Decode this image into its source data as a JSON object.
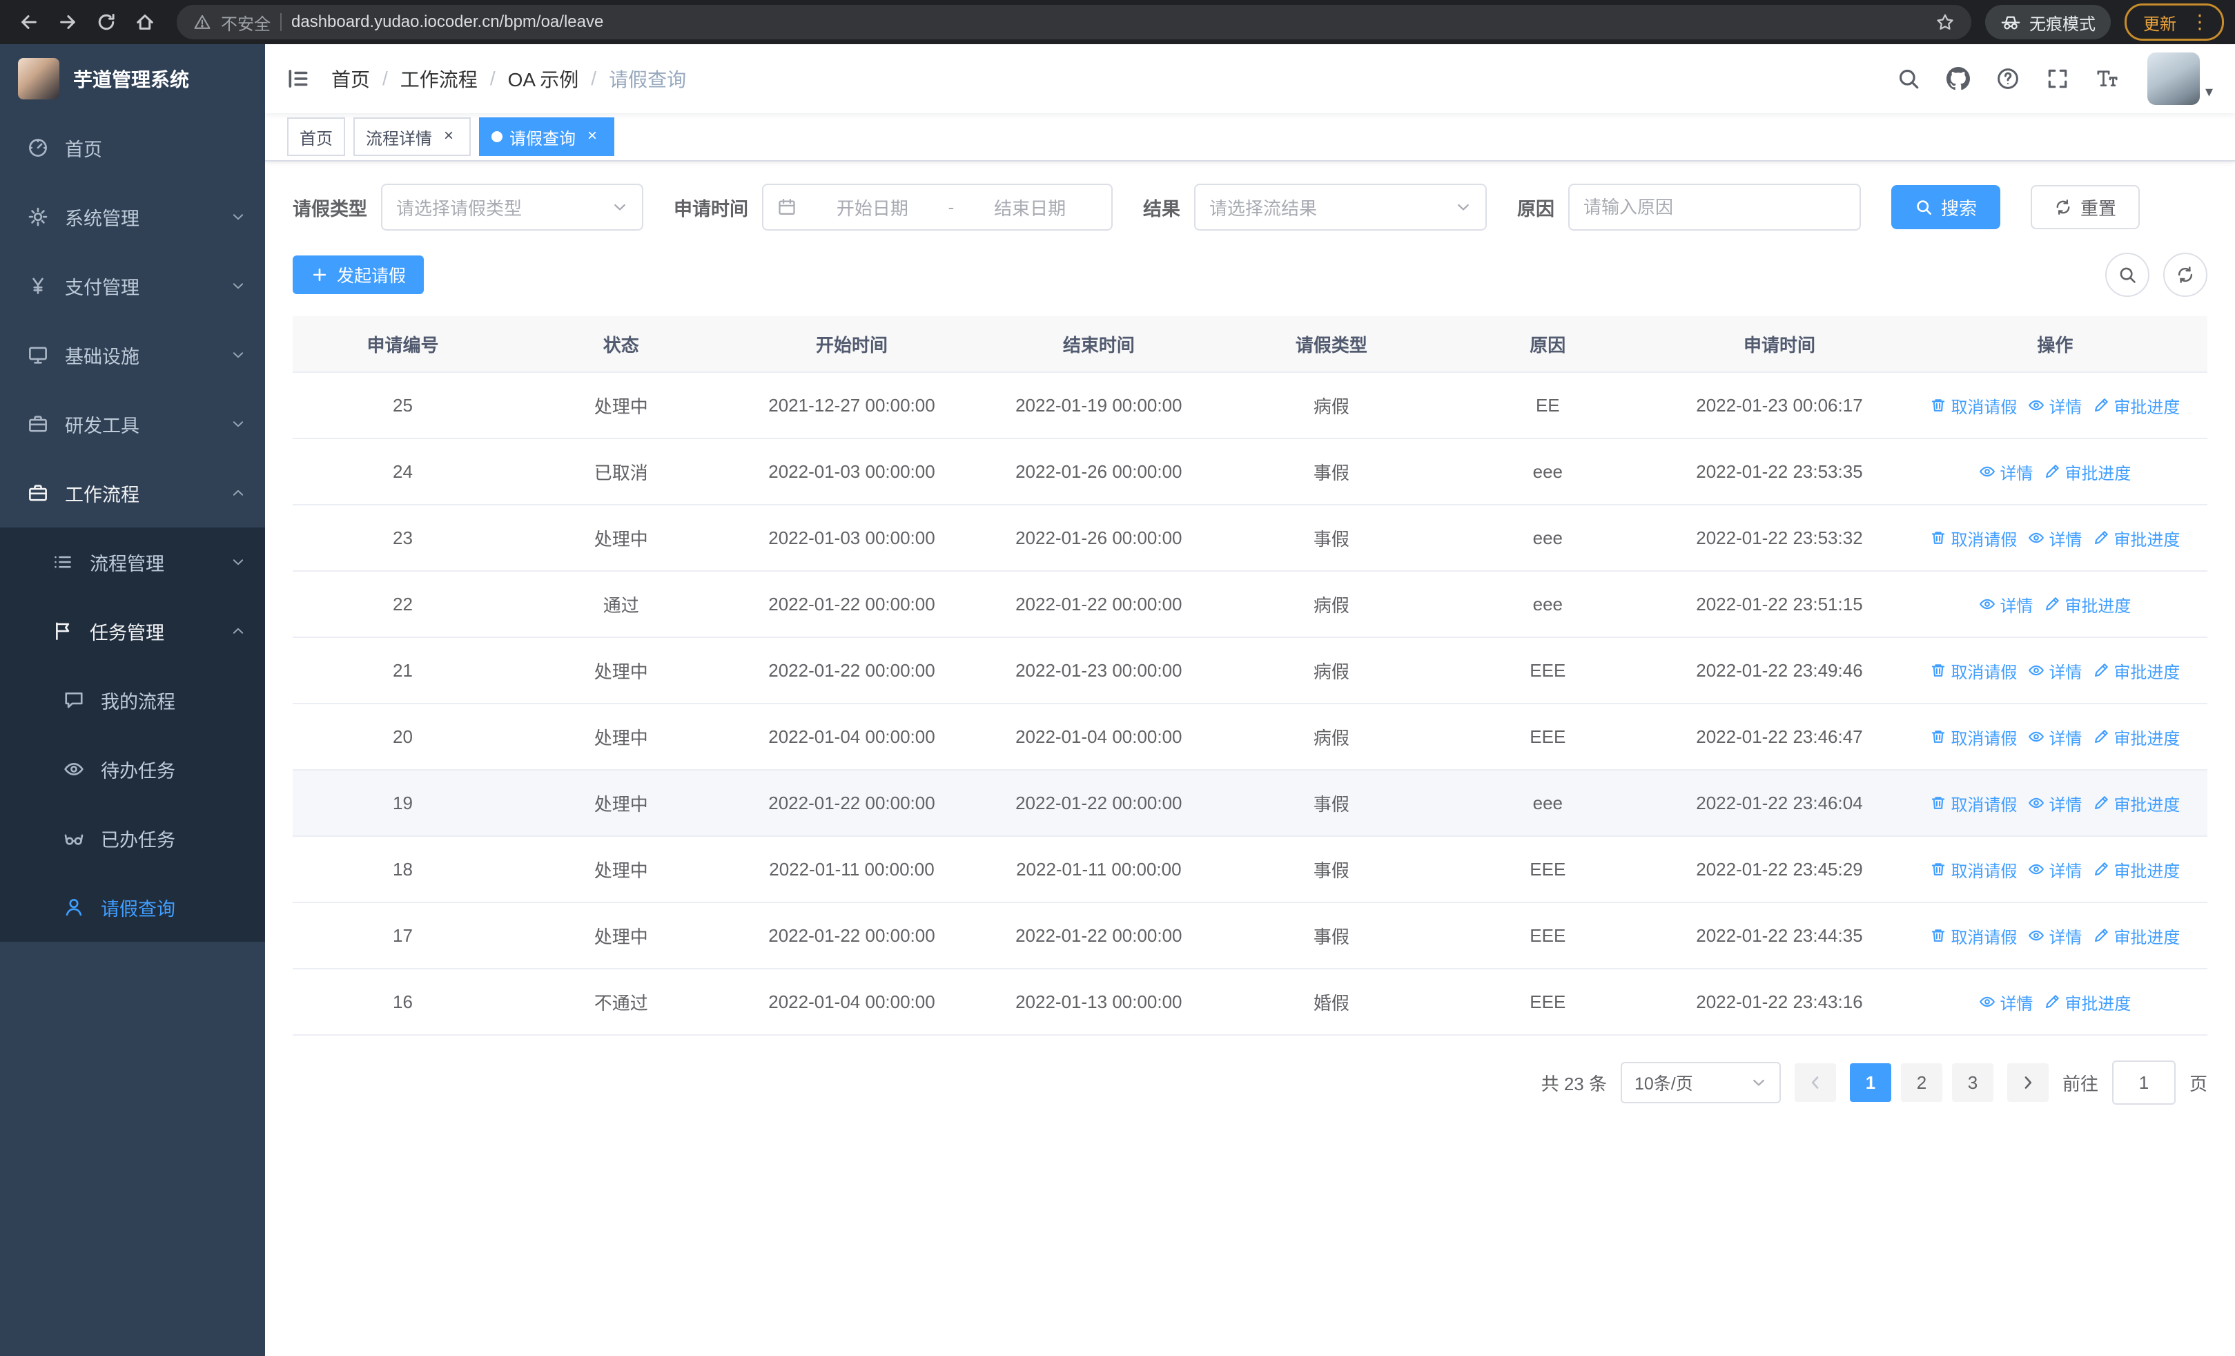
{
  "browser": {
    "security_chip": "不安全",
    "url": "dashboard.yudao.iocoder.cn/bpm/oa/leave",
    "incognito_label": "无痕模式",
    "update_label": "更新"
  },
  "app": {
    "logo_title": "芋道管理系统"
  },
  "sidebar": {
    "menu": [
      {
        "key": "home",
        "label": "首页",
        "icon": "dashboard-icon",
        "level": 1
      },
      {
        "key": "system",
        "label": "系统管理",
        "icon": "gear-icon",
        "level": 1,
        "arrow": "down"
      },
      {
        "key": "payment",
        "label": "支付管理",
        "icon": "yen-icon",
        "level": 1,
        "arrow": "down"
      },
      {
        "key": "infrastructure",
        "label": "基础设施",
        "icon": "monitor-icon",
        "level": 1,
        "arrow": "down"
      },
      {
        "key": "dev-tools",
        "label": "研发工具",
        "icon": "briefcase-icon",
        "level": 1,
        "arrow": "down"
      },
      {
        "key": "workflow",
        "label": "工作流程",
        "icon": "suitcase-icon",
        "level": 1,
        "arrow": "up",
        "open": true
      },
      {
        "key": "process-mgmt",
        "label": "流程管理",
        "icon": "list-icon",
        "level": 2,
        "arrow": "down"
      },
      {
        "key": "task-mgmt",
        "label": "任务管理",
        "icon": "flag-icon",
        "level": 2,
        "arrow": "up",
        "open": true
      },
      {
        "key": "my-process",
        "label": "我的流程",
        "icon": "chat-icon",
        "level": 3
      },
      {
        "key": "todo-tasks",
        "label": "待办任务",
        "icon": "eye-icon",
        "level": 3
      },
      {
        "key": "done-tasks",
        "label": "已办任务",
        "icon": "done-icon",
        "level": 3
      },
      {
        "key": "leave-query",
        "label": "请假查询",
        "icon": "user-icon",
        "level": 3,
        "active": true
      }
    ]
  },
  "header": {
    "breadcrumb": [
      "首页",
      "工作流程",
      "OA 示例",
      "请假查询"
    ]
  },
  "tags": [
    {
      "label": "首页",
      "closable": false,
      "active": false
    },
    {
      "label": "流程详情",
      "closable": true,
      "active": false
    },
    {
      "label": "请假查询",
      "closable": true,
      "active": true
    }
  ],
  "filters": {
    "leave_type_label": "请假类型",
    "leave_type_placeholder": "请选择请假类型",
    "apply_time_label": "申请时间",
    "start_placeholder": "开始日期",
    "range_separator": "-",
    "end_placeholder": "结束日期",
    "result_label": "结果",
    "result_placeholder": "请选择流结果",
    "reason_label": "原因",
    "reason_placeholder": "请输入原因",
    "search_label": "搜索",
    "reset_label": "重置"
  },
  "toolbar": {
    "create_label": "发起请假"
  },
  "table": {
    "columns": [
      "申请编号",
      "状态",
      "开始时间",
      "结束时间",
      "请假类型",
      "原因",
      "申请时间",
      "操作"
    ],
    "action_labels": {
      "cancel": "取消请假",
      "detail": "详情",
      "progress": "审批进度"
    },
    "rows": [
      {
        "id": "25",
        "status": "处理中",
        "start": "2021-12-27 00:00:00",
        "end": "2022-01-19 00:00:00",
        "type": "病假",
        "reason": "EE",
        "applied": "2022-01-23 00:06:17",
        "actions": [
          "cancel",
          "detail",
          "progress"
        ]
      },
      {
        "id": "24",
        "status": "已取消",
        "start": "2022-01-03 00:00:00",
        "end": "2022-01-26 00:00:00",
        "type": "事假",
        "reason": "eee",
        "applied": "2022-01-22 23:53:35",
        "actions": [
          "detail",
          "progress"
        ]
      },
      {
        "id": "23",
        "status": "处理中",
        "start": "2022-01-03 00:00:00",
        "end": "2022-01-26 00:00:00",
        "type": "事假",
        "reason": "eee",
        "applied": "2022-01-22 23:53:32",
        "actions": [
          "cancel",
          "detail",
          "progress"
        ]
      },
      {
        "id": "22",
        "status": "通过",
        "start": "2022-01-22 00:00:00",
        "end": "2022-01-22 00:00:00",
        "type": "病假",
        "reason": "eee",
        "applied": "2022-01-22 23:51:15",
        "actions": [
          "detail",
          "progress"
        ]
      },
      {
        "id": "21",
        "status": "处理中",
        "start": "2022-01-22 00:00:00",
        "end": "2022-01-23 00:00:00",
        "type": "病假",
        "reason": "EEE",
        "applied": "2022-01-22 23:49:46",
        "actions": [
          "cancel",
          "detail",
          "progress"
        ]
      },
      {
        "id": "20",
        "status": "处理中",
        "start": "2022-01-04 00:00:00",
        "end": "2022-01-04 00:00:00",
        "type": "病假",
        "reason": "EEE",
        "applied": "2022-01-22 23:46:47",
        "actions": [
          "cancel",
          "detail",
          "progress"
        ]
      },
      {
        "id": "19",
        "status": "处理中",
        "start": "2022-01-22 00:00:00",
        "end": "2022-01-22 00:00:00",
        "type": "事假",
        "reason": "eee",
        "applied": "2022-01-22 23:46:04",
        "actions": [
          "cancel",
          "detail",
          "progress"
        ],
        "highlighted": true
      },
      {
        "id": "18",
        "status": "处理中",
        "start": "2022-01-11 00:00:00",
        "end": "2022-01-11 00:00:00",
        "type": "事假",
        "reason": "EEE",
        "applied": "2022-01-22 23:45:29",
        "actions": [
          "cancel",
          "detail",
          "progress"
        ]
      },
      {
        "id": "17",
        "status": "处理中",
        "start": "2022-01-22 00:00:00",
        "end": "2022-01-22 00:00:00",
        "type": "事假",
        "reason": "EEE",
        "applied": "2022-01-22 23:44:35",
        "actions": [
          "cancel",
          "detail",
          "progress"
        ]
      },
      {
        "id": "16",
        "status": "不通过",
        "start": "2022-01-04 00:00:00",
        "end": "2022-01-13 00:00:00",
        "type": "婚假",
        "reason": "EEE",
        "applied": "2022-01-22 23:43:16",
        "actions": [
          "detail",
          "progress"
        ]
      }
    ]
  },
  "pagination": {
    "total_text": "共 23 条",
    "page_size": "10条/页",
    "pages": [
      "1",
      "2",
      "3"
    ],
    "active_page": "1",
    "goto_label": "前往",
    "goto_value": "1",
    "goto_suffix": "页"
  },
  "colors": {
    "primary": "#409eff",
    "sidebar_bg": "#304156",
    "sidebar_sub_bg": "#1f2d3d"
  }
}
